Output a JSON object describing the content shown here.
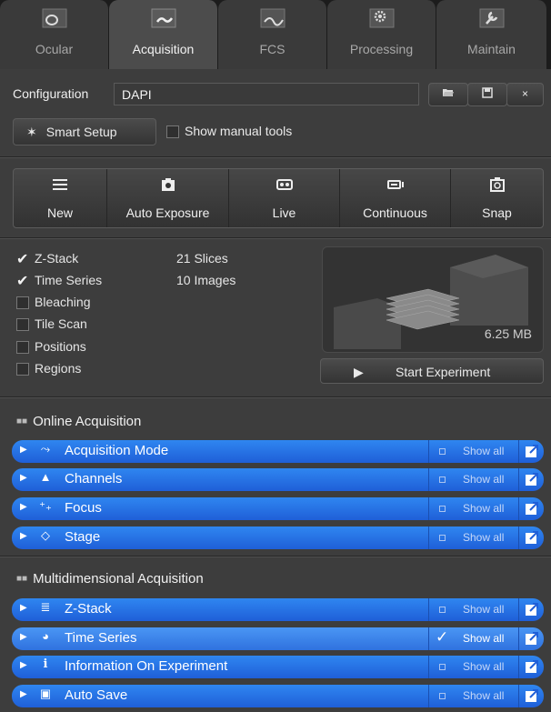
{
  "tabs": [
    {
      "label": "Ocular",
      "icon": "ocular-icon",
      "active": false
    },
    {
      "label": "Acquisition",
      "icon": "acquisition-icon",
      "active": true
    },
    {
      "label": "FCS",
      "icon": "fcs-icon",
      "active": false
    },
    {
      "label": "Processing",
      "icon": "processing-gear-icon",
      "active": false
    },
    {
      "label": "Maintain",
      "icon": "maintain-wrench-icon",
      "active": false
    }
  ],
  "configuration": {
    "label": "Configuration",
    "value": "DAPI",
    "buttons": [
      "open-folder-icon",
      "save-disk-icon",
      "close-x-icon"
    ],
    "close_glyph": "×"
  },
  "smart_setup": {
    "label": "Smart Setup",
    "icon": "star-burst-icon"
  },
  "show_manual_tools": {
    "label": "Show manual tools",
    "checked": false
  },
  "toolbar": [
    {
      "label": "New",
      "icon": "new-list-icon"
    },
    {
      "label": "Auto Exposure",
      "icon": "camera-auto-icon"
    },
    {
      "label": "Live",
      "icon": "live-camera-icon"
    },
    {
      "label": "Continuous",
      "icon": "continuous-camera-icon"
    },
    {
      "label": "Snap",
      "icon": "snap-camera-icon"
    }
  ],
  "dimensions": [
    {
      "label": "Z-Stack",
      "checked": true,
      "value": "21 Slices"
    },
    {
      "label": "Time Series",
      "checked": true,
      "value": "10 Images"
    },
    {
      "label": "Bleaching",
      "checked": false,
      "value": ""
    },
    {
      "label": "Tile Scan",
      "checked": false,
      "value": ""
    },
    {
      "label": "Positions",
      "checked": false,
      "value": ""
    },
    {
      "label": "Regions",
      "checked": false,
      "value": ""
    }
  ],
  "preview": {
    "size": "6.25 MB"
  },
  "start_experiment": {
    "label": "Start Experiment",
    "icon": "play-icon"
  },
  "online_acquisition": {
    "title": "Online Acquisition",
    "rows": [
      {
        "label": "Acquisition Mode",
        "icon": "acquisition-mode-icon",
        "show_all": "Show all",
        "show_all_checked": false,
        "glyph": "⤳"
      },
      {
        "label": "Channels",
        "icon": "channels-icon",
        "show_all": "Show all",
        "show_all_checked": false,
        "glyph": "▲"
      },
      {
        "label": "Focus",
        "icon": "focus-icon",
        "show_all": "Show all",
        "show_all_checked": false,
        "glyph": "⁺₊"
      },
      {
        "label": "Stage",
        "icon": "stage-icon",
        "show_all": "Show all",
        "show_all_checked": false,
        "glyph": "◇"
      }
    ]
  },
  "multidimensional_acquisition": {
    "title": "Multidimensional Acquisition",
    "rows": [
      {
        "label": "Z-Stack",
        "icon": "z-stack-icon",
        "show_all": "Show all",
        "show_all_checked": false,
        "glyph": "≣"
      },
      {
        "label": "Time Series",
        "icon": "clock-icon",
        "show_all": "Show all",
        "show_all_checked": true,
        "glyph": "◕"
      },
      {
        "label": "Information On Experiment",
        "icon": "info-icon",
        "show_all": "Show all",
        "show_all_checked": false,
        "glyph": "i"
      },
      {
        "label": "Auto Save",
        "icon": "save-disk-icon",
        "show_all": "Show all",
        "show_all_checked": false,
        "glyph": "▣"
      }
    ]
  },
  "colors": {
    "accent_blue": "#2f86f0",
    "panel": "#3d3d3d",
    "tab_bar": "#1c1c1c"
  }
}
